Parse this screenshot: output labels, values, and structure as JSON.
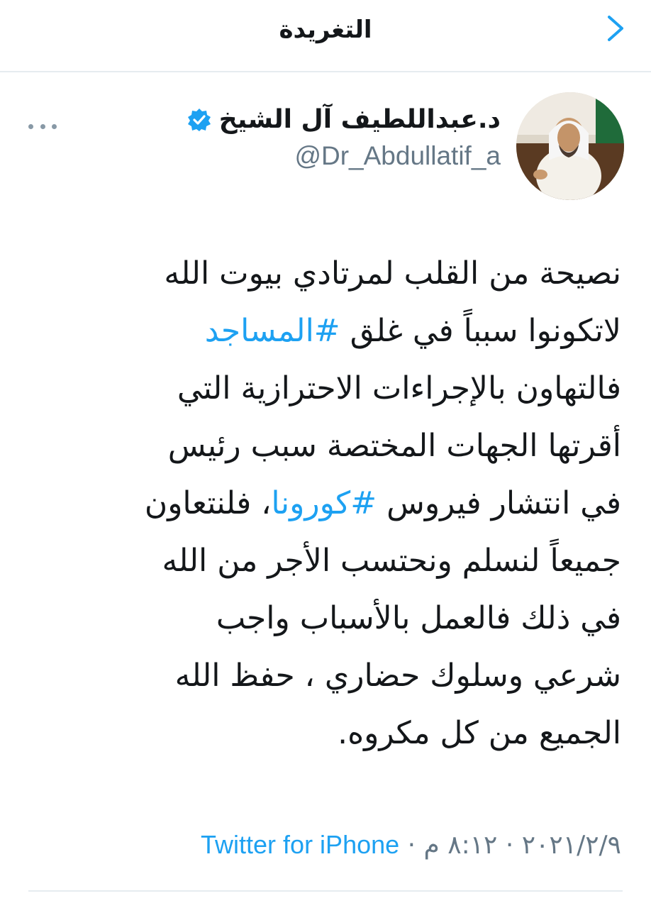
{
  "header": {
    "title": "التغريدة",
    "back_icon": "chevron-back-icon"
  },
  "author": {
    "name": "د.عبداللطيف آل الشيخ",
    "handle": "@Dr_Abdullatif_a",
    "verified_icon": "verified-badge-icon"
  },
  "tweet": {
    "lines": [
      {
        "text": "نصيحة من القلب لمرتادي بيوت الله"
      },
      {
        "before": "لاتكونوا سبباً في غلق ",
        "hashtag": "#المساجد"
      },
      {
        "text": "فالتهاون بالإجراءات الاحترازية التي"
      },
      {
        "text": "أقرتها الجهات المختصة سبب رئيس"
      },
      {
        "before": "في انتشار  فيروس ",
        "hashtag": "#كورونا",
        "after": "، فلنتعاون"
      },
      {
        "text": "جميعاً لنسلم ونحتسب الأجر من الله"
      },
      {
        "text": "في ذلك فالعمل بالأسباب واجب"
      },
      {
        "text": "شرعي وسلوك حضاري ، حفظ الله"
      },
      {
        "text": "الجميع من كل مكروه."
      }
    ]
  },
  "meta": {
    "date": "٢٠٢١/٢/٩",
    "separator": " · ",
    "time": "٨:١٢ م",
    "source": "Twitter for iPhone"
  },
  "colors": {
    "accent": "#1da1f2",
    "secondary_text": "#657786",
    "divider": "#e6ecf0"
  }
}
